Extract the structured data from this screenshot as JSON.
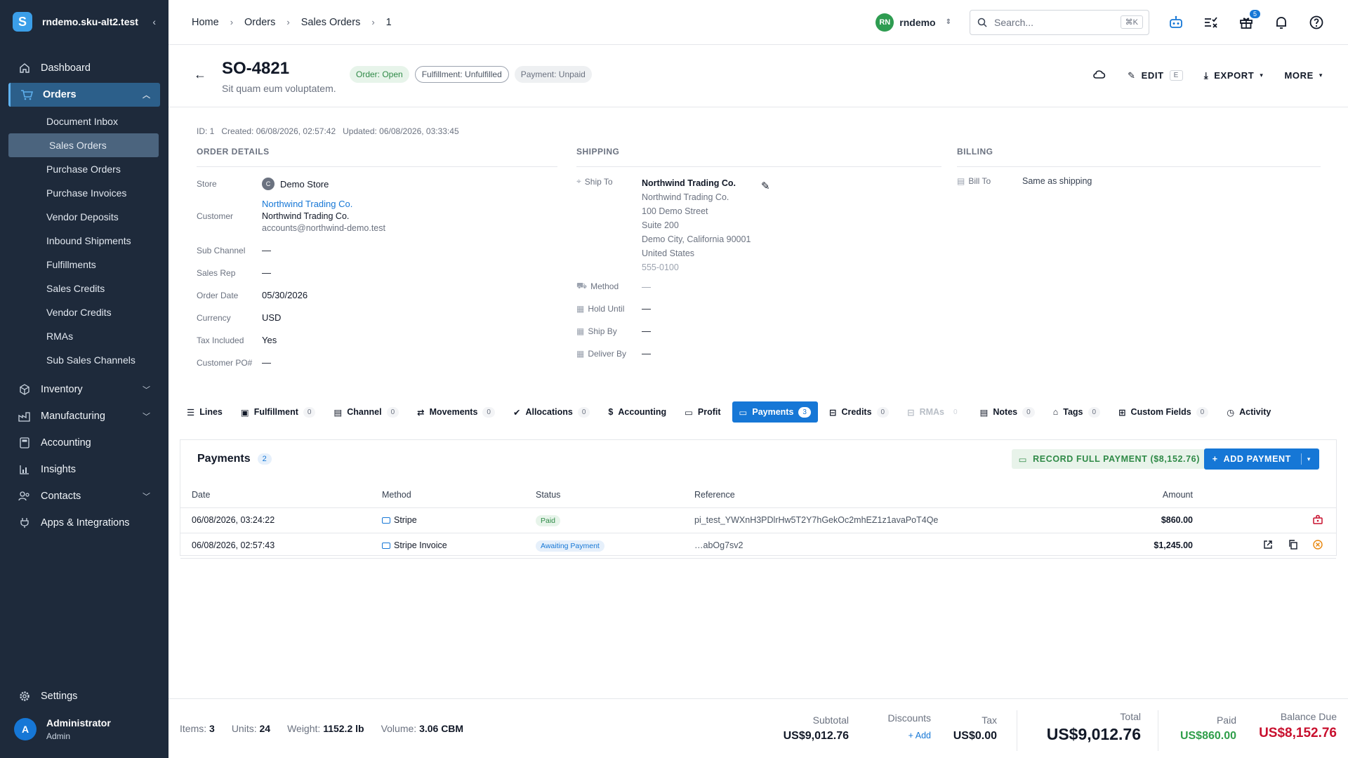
{
  "sidebar": {
    "logo": "S",
    "store": "rndemo.sku-alt2.test",
    "collapse": "‹",
    "nav": [
      {
        "label": "Dashboard"
      },
      {
        "label": "Orders"
      },
      {
        "label": "Inventory"
      },
      {
        "label": "Manufacturing"
      },
      {
        "label": "Accounting"
      },
      {
        "label": "Insights"
      },
      {
        "label": "Contacts"
      },
      {
        "label": "Apps & Integrations"
      }
    ],
    "orders_sub": [
      "Document Inbox",
      "Sales Orders",
      "Purchase Orders",
      "Purchase Invoices",
      "Vendor Deposits",
      "Inbound Shipments",
      "Fulfillments",
      "Sales Credits",
      "Vendor Credits",
      "RMAs",
      "Sub Sales Channels"
    ],
    "settings": "Settings",
    "user": {
      "initial": "A",
      "name": "Administrator",
      "role": "Admin"
    }
  },
  "topbar": {
    "breadcrumbs": [
      "Home",
      "Orders",
      "Sales Orders",
      "1"
    ],
    "org_initials": "RN",
    "org_name": "rndemo",
    "search_placeholder": "Search...",
    "search_shortcut": "⌘K",
    "gift_badge": "5"
  },
  "order": {
    "number": "SO-4821",
    "subtitle": "Sit quam eum voluptatem.",
    "chips": {
      "order": "Order: Open",
      "fulfillment": "Fulfillment: Unfulfilled",
      "payment": "Payment: Unpaid"
    },
    "actions": {
      "edit": "EDIT",
      "edit_key": "E",
      "export": "EXPORT",
      "more": "MORE"
    },
    "meta": {
      "id": "ID: 1",
      "created": "Created: 06/08/2026, 02:57:42",
      "updated": "Updated: 06/08/2026, 03:33:45"
    }
  },
  "details": {
    "heading": "ORDER DETAILS",
    "store_label": "Store",
    "store_initial": "C",
    "store": "Demo Store",
    "customer_label": "Customer",
    "customer_link": "Northwind Trading Co.",
    "customer_name": "Northwind Trading Co.",
    "customer_email": "accounts@northwind-demo.test",
    "sub_channel_label": "Sub Channel",
    "sub_channel": "—",
    "sales_rep_label": "Sales Rep",
    "sales_rep": "—",
    "order_date_label": "Order Date",
    "order_date": "05/30/2026",
    "currency_label": "Currency",
    "currency": "USD",
    "tax_included_label": "Tax Included",
    "tax_included": "Yes",
    "customer_po_label": "Customer PO#",
    "customer_po": "—"
  },
  "shipping": {
    "heading": "SHIPPING",
    "ship_to_label": "Ship To",
    "name": "Northwind Trading Co.",
    "lines": [
      "Northwind Trading Co.",
      "100 Demo Street",
      "Suite 200",
      "Demo City, California 90001",
      "United States"
    ],
    "phone": "555-0100",
    "method_label": "Method",
    "method": "—",
    "hold_until_label": "Hold Until",
    "hold_until": "—",
    "ship_by_label": "Ship By",
    "ship_by": "—",
    "deliver_by_label": "Deliver By",
    "deliver_by": "—"
  },
  "billing": {
    "heading": "BILLING",
    "bill_to_label": "Bill To",
    "bill_to": "Same as shipping"
  },
  "tabs": [
    {
      "label": "Lines"
    },
    {
      "label": "Fulfillment",
      "count": "0"
    },
    {
      "label": "Channel",
      "count": "0"
    },
    {
      "label": "Movements",
      "count": "0"
    },
    {
      "label": "Allocations",
      "count": "0"
    },
    {
      "label": "Accounting"
    },
    {
      "label": "Profit"
    },
    {
      "label": "Payments",
      "count": "3"
    },
    {
      "label": "Credits",
      "count": "0"
    },
    {
      "label": "RMAs",
      "count": "0"
    },
    {
      "label": "Notes",
      "count": "0"
    },
    {
      "label": "Tags",
      "count": "0"
    },
    {
      "label": "Custom Fields",
      "count": "0"
    },
    {
      "label": "Activity"
    }
  ],
  "payments": {
    "title": "Payments",
    "count": "2",
    "record_button": "RECORD FULL PAYMENT ($8,152.76)",
    "add_button": "ADD PAYMENT",
    "columns": [
      "Date",
      "Method",
      "Status",
      "Reference",
      "Amount"
    ],
    "rows": [
      {
        "date": "06/08/2026, 03:24:22",
        "method": "Stripe",
        "status": "Paid",
        "reference": "pi_test_YWXnH3PDlrHw5T2Y7hGekOc2mhEZ1z1avaPoT4Qe",
        "amount": "$860.00"
      },
      {
        "date": "06/08/2026, 02:57:43",
        "method": "Stripe Invoice",
        "status": "Awaiting Payment",
        "reference": "…abOg7sv2",
        "amount": "$1,245.00"
      }
    ]
  },
  "footer": {
    "items_label": "Items:",
    "items": "3",
    "units_label": "Units:",
    "units": "24",
    "weight_label": "Weight:",
    "weight": "1152.2 lb",
    "volume_label": "Volume:",
    "volume": "3.06 CBM",
    "subtotal_label": "Subtotal",
    "subtotal": "US$9,012.76",
    "discounts_label": "Discounts",
    "discounts_add": "Add",
    "tax_label": "Tax",
    "tax": "US$0.00",
    "total_label": "Total",
    "total": "US$9,012.76",
    "paid_label": "Paid",
    "paid": "US$860.00",
    "balance_label": "Balance Due",
    "balance": "US$8,152.76"
  },
  "colors": {
    "accent": "#1677d6",
    "sidebar": "#1e2a3b",
    "paid": "#2f8a47",
    "balance": "#c8102e"
  }
}
